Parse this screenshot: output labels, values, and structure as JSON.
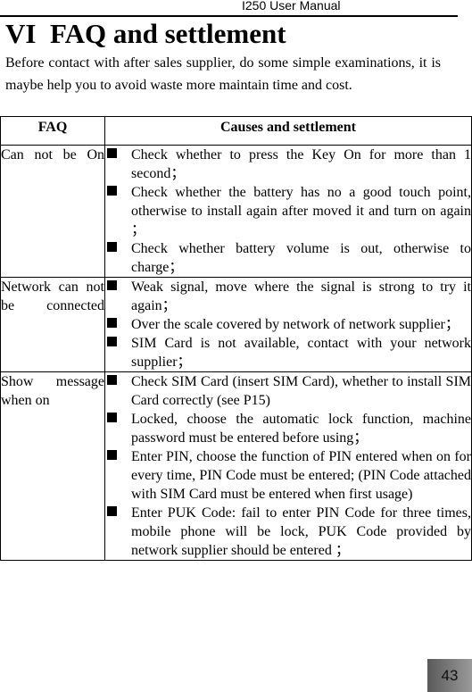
{
  "header": {
    "running_title": "I250 User Manual"
  },
  "section": {
    "title": "VI  FAQ and settlement",
    "intro": "Before contact with after sales supplier, do some simple examinations, it is maybe help you to avoid waste more maintain time and cost."
  },
  "table": {
    "columns": [
      "FAQ",
      "Causes and settlement"
    ],
    "rows": [
      {
        "question": "Can not be On",
        "causes": [
          "Check whether to press the Key On for more than 1 second；",
          "Check whether the battery has no a good touch point, otherwise to install again after moved it and turn on again ；",
          "Check whether battery volume is out, otherwise to charge；"
        ]
      },
      {
        "question": "Network can not be connected",
        "causes": [
          "Weak signal, move where the signal is strong to try it again；",
          "Over the scale covered by network of network supplier；",
          "SIM Card is not available, contact with your network supplier；"
        ]
      },
      {
        "question": "Show message when on",
        "causes": [
          "Check SIM Card (insert SIM Card), whether to install SIM Card correctly (see P15)",
          "Locked, choose the automatic lock function, machine password must be entered before using；",
          "Enter PIN, choose the function of PIN entered when on for every time, PIN Code must be entered; (PIN Code attached with SIM Card must be entered when first usage)",
          "Enter PUK Code: fail to enter PIN Code for three times, mobile phone will be lock, PUK Code provided by network supplier should be entered ；"
        ]
      }
    ]
  },
  "footer": {
    "page_number": "43"
  },
  "icons": {
    "bullet": "square-bullet-icon"
  }
}
